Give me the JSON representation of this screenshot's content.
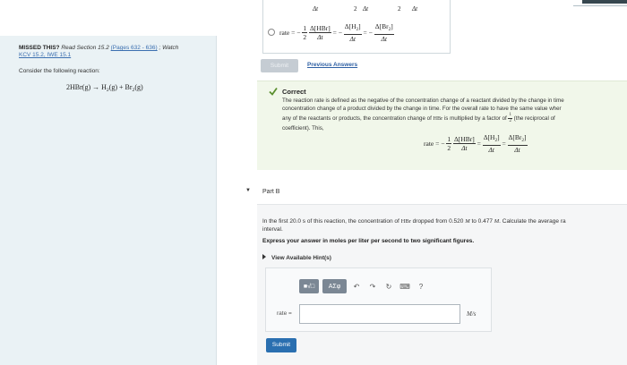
{
  "left": {
    "missed_label": "MISSED THIS?",
    "read_text": " Read Section 15.2 ",
    "pages_link": "(Pages 632 - 636)",
    "watch_text": " ; Watch ",
    "kcv_link": "KCV 15.2, IWE 15.1",
    "consider": "Consider the following reaction:",
    "reaction": {
      "c1": "2HBr",
      "s1": "(g)",
      "arrow": " → ",
      "c2": "H",
      "c2sub": "2",
      "s2": "(g)",
      "plus": " + ",
      "c3": "Br",
      "c3sub": "2",
      "s3": "(g)"
    }
  },
  "option": {
    "top_row": [
      "Δt",
      "2",
      "Δt",
      "2",
      "Δt"
    ],
    "rate_word": "rate",
    "eq": "=",
    "minus": "−",
    "coef_num": "1",
    "coef_den": "2",
    "hbr_num": "Δ[HBr]",
    "h2_num": "Δ[H",
    "br2_num": "Δ[Br",
    "sub2": "2",
    "close": "]",
    "den": "Δt"
  },
  "submit_disabled": "Submit",
  "previous_answers": "Previous Answers",
  "correct": {
    "title": "Correct",
    "line1": "The reaction rate is defined as the negative of the concentration change of a reactant divided by the change in time",
    "line2": "concentration change of a product divided by the change in time. For the overall rate to have the same value wher",
    "line3a": "any of the reactants or products, the concentration change of ",
    "line3b": "HBr",
    "line3c": " is multiplied by a factor of ",
    "half_num": "1",
    "half_den": "2",
    "line3d": " (the reciprocal of",
    "line4": "coefficient). This,"
  },
  "part_b": {
    "toggle": "▼",
    "label": "Part B",
    "q1": "In the first 20.0 s of this reaction, the concentration of ",
    "q_hbr": "HBr",
    "q2": " dropped from 0.520 ",
    "q_m1": "M",
    "q3": " to 0.477 ",
    "q_m2": "M",
    "q4": ". Calculate the average ra",
    "q5": "interval.",
    "instruction": "Express your answer in moles per liter per second to two significant figures.",
    "hints": "View Available Hint(s)",
    "toolbar": {
      "templates": "■√□",
      "greek": "ΑΣφ",
      "undo": "↶",
      "redo": "↷",
      "reset": "↻",
      "keyboard": "⌨",
      "help": "?"
    },
    "input_label": "rate =",
    "input_value": "",
    "unit": "M/s",
    "submit": "Submit"
  },
  "colors": {
    "left_panel_bg": "#eaf2f5",
    "correct_bg": "#f1f7ea",
    "check_green": "#5a8f2e",
    "submit_blue": "#2a6fb0",
    "link_blue": "#3b6fb0"
  }
}
